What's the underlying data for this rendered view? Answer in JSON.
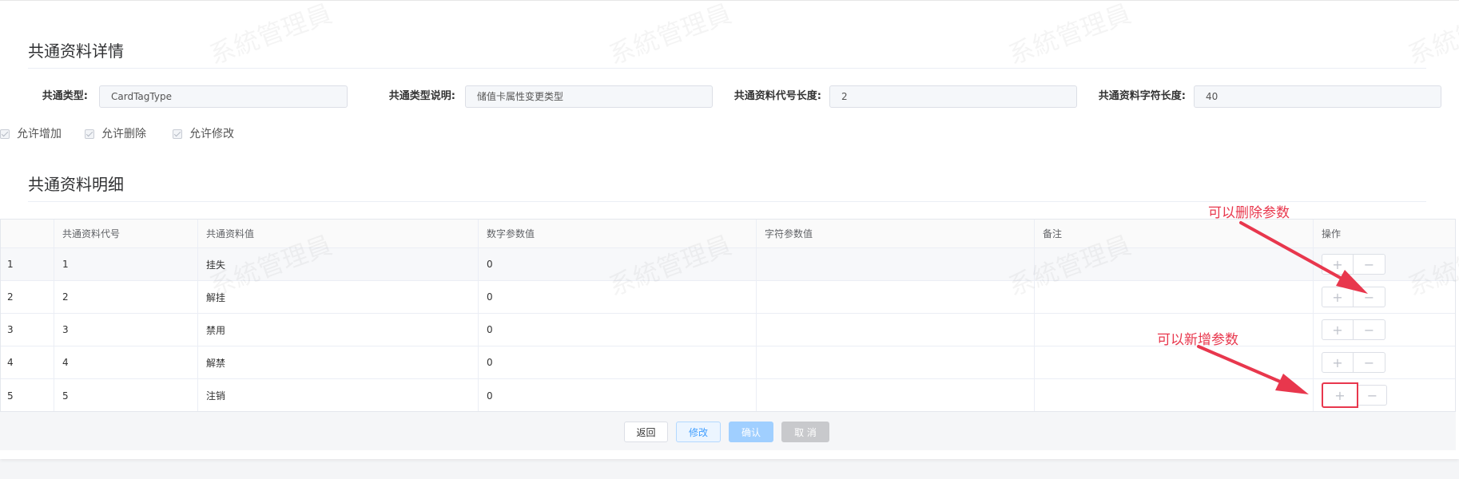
{
  "detail": {
    "title": "共通资料详情",
    "fields": [
      {
        "label": "共通类型:",
        "value": "CardTagType"
      },
      {
        "label": "共通类型说明:",
        "value": "储值卡属性变更类型"
      },
      {
        "label": "共通资料代号长度:",
        "value": "2"
      },
      {
        "label": "共通资料字符长度:",
        "value": "40"
      }
    ],
    "checkboxes": [
      "允许增加",
      "允许删除",
      "允许修改"
    ]
  },
  "list": {
    "title": "共通资料明细",
    "columns": [
      "共通资料代号",
      "共通资料值",
      "数字参数值",
      "字符参数值",
      "备注",
      "操作"
    ],
    "rows": [
      {
        "index": "1",
        "code": "1",
        "value": "挂失",
        "num": "0",
        "str": "",
        "remark": ""
      },
      {
        "index": "2",
        "code": "2",
        "value": "解挂",
        "num": "0",
        "str": "",
        "remark": ""
      },
      {
        "index": "3",
        "code": "3",
        "value": "禁用",
        "num": "0",
        "str": "",
        "remark": ""
      },
      {
        "index": "4",
        "code": "4",
        "value": "解禁",
        "num": "0",
        "str": "",
        "remark": ""
      },
      {
        "index": "5",
        "code": "5",
        "value": "注销",
        "num": "0",
        "str": "",
        "remark": ""
      }
    ],
    "op_plus": "+",
    "op_minus": "−"
  },
  "footer": {
    "back": "返回",
    "edit": "修改",
    "confirm": "确认",
    "cancel": "取 消"
  },
  "annotations": {
    "delete_hint": "可以删除参数",
    "add_hint": "可以新增参数"
  },
  "watermark": "系統管理員",
  "colors": {
    "annotation_red": "#e8374d",
    "primary_blue": "#409eff",
    "confirm_bg": "#a0cfff"
  }
}
